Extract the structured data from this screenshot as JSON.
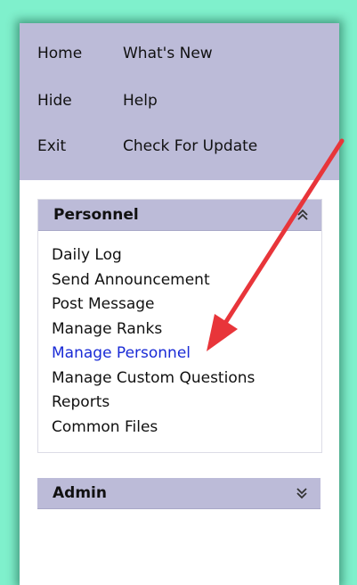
{
  "menu": {
    "items": [
      {
        "label": "Home"
      },
      {
        "label": "What's New"
      },
      {
        "label": "Hide"
      },
      {
        "label": "Help"
      },
      {
        "label": "Exit"
      },
      {
        "label": "Check For Update"
      }
    ]
  },
  "personnel": {
    "title": "Personnel",
    "toggle_icon": "chevron-double-up-icon",
    "links": [
      {
        "label": "Daily Log"
      },
      {
        "label": "Send Announcement"
      },
      {
        "label": "Post Message"
      },
      {
        "label": "Manage Ranks"
      },
      {
        "label": "Manage Personnel",
        "highlighted": true
      },
      {
        "label": "Manage Custom Questions"
      },
      {
        "label": "Reports"
      },
      {
        "label": "Common Files"
      }
    ]
  },
  "admin": {
    "title": "Admin",
    "toggle_icon": "chevron-double-down-icon"
  },
  "colors": {
    "background": "#7ff0cc",
    "menu_bg": "#bcbbd8",
    "link_active": "#1a2bd6",
    "annotation_arrow": "#e8353a"
  }
}
